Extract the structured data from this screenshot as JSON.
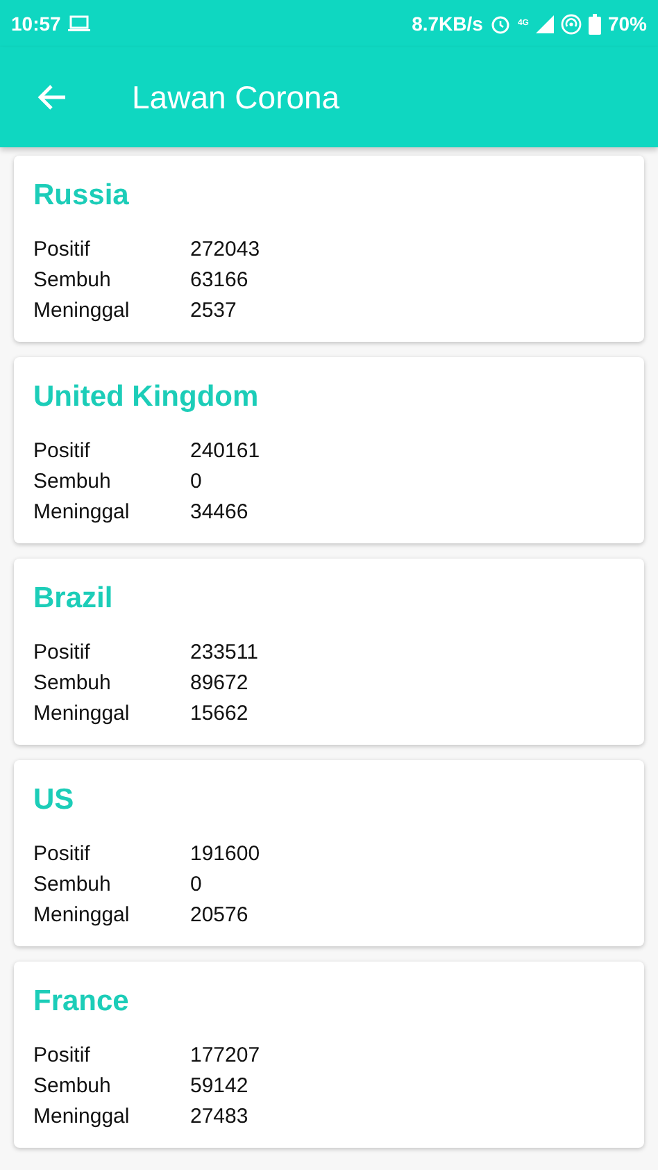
{
  "status_bar": {
    "time": "10:57",
    "speed": "8.7KB/s",
    "network": "4G",
    "battery": "70%"
  },
  "app_bar": {
    "title": "Lawan Corona"
  },
  "countries": [
    {
      "name": "Russia",
      "stats": [
        {
          "label": "Positif",
          "value": "272043"
        },
        {
          "label": "Sembuh",
          "value": "63166"
        },
        {
          "label": "Meninggal",
          "value": "2537"
        }
      ]
    },
    {
      "name": "United Kingdom",
      "stats": [
        {
          "label": "Positif",
          "value": "240161"
        },
        {
          "label": "Sembuh",
          "value": "0"
        },
        {
          "label": "Meninggal",
          "value": "34466"
        }
      ]
    },
    {
      "name": "Brazil",
      "stats": [
        {
          "label": "Positif",
          "value": "233511"
        },
        {
          "label": "Sembuh",
          "value": "89672"
        },
        {
          "label": "Meninggal",
          "value": "15662"
        }
      ]
    },
    {
      "name": "US",
      "stats": [
        {
          "label": "Positif",
          "value": "191600"
        },
        {
          "label": "Sembuh",
          "value": "0"
        },
        {
          "label": "Meninggal",
          "value": "20576"
        }
      ]
    },
    {
      "name": "France",
      "stats": [
        {
          "label": "Positif",
          "value": "177207"
        },
        {
          "label": "Sembuh",
          "value": "59142"
        },
        {
          "label": "Meninggal",
          "value": "27483"
        }
      ]
    }
  ]
}
